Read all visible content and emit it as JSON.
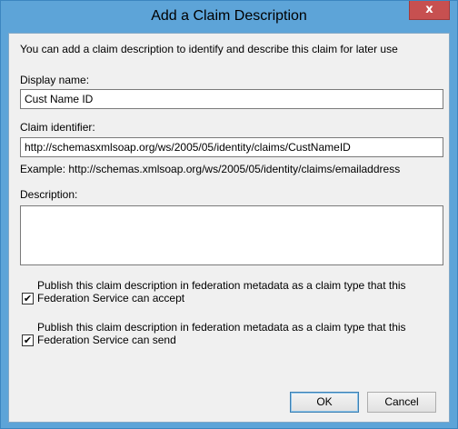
{
  "window": {
    "title": "Add a Claim Description",
    "close_glyph": "x"
  },
  "intro": "You can add a claim description to identify and describe this claim for later use",
  "display_name": {
    "label": "Display name:",
    "value": "Cust Name ID"
  },
  "claim_identifier": {
    "label": "Claim identifier:",
    "value": "http://schemasxmlsoap.org/ws/2005/05/identity/claims/CustNameID",
    "example": "Example: http://schemas.xmlsoap.org/ws/2005/05/identity/claims/emailaddress"
  },
  "description": {
    "label": "Description:",
    "value": ""
  },
  "publish_accept": {
    "checked": true,
    "check_glyph": "✔",
    "label": "Publish this claim description in federation metadata as a claim type that this Federation Service can accept"
  },
  "publish_send": {
    "checked": true,
    "check_glyph": "✔",
    "label": "Publish this claim description in federation metadata as a claim type that this Federation Service can send"
  },
  "buttons": {
    "ok": "OK",
    "cancel": "Cancel"
  },
  "colors": {
    "title_bar": "#5da4d8",
    "close_button": "#c75050",
    "dialog_bg": "#f0f0f0"
  }
}
